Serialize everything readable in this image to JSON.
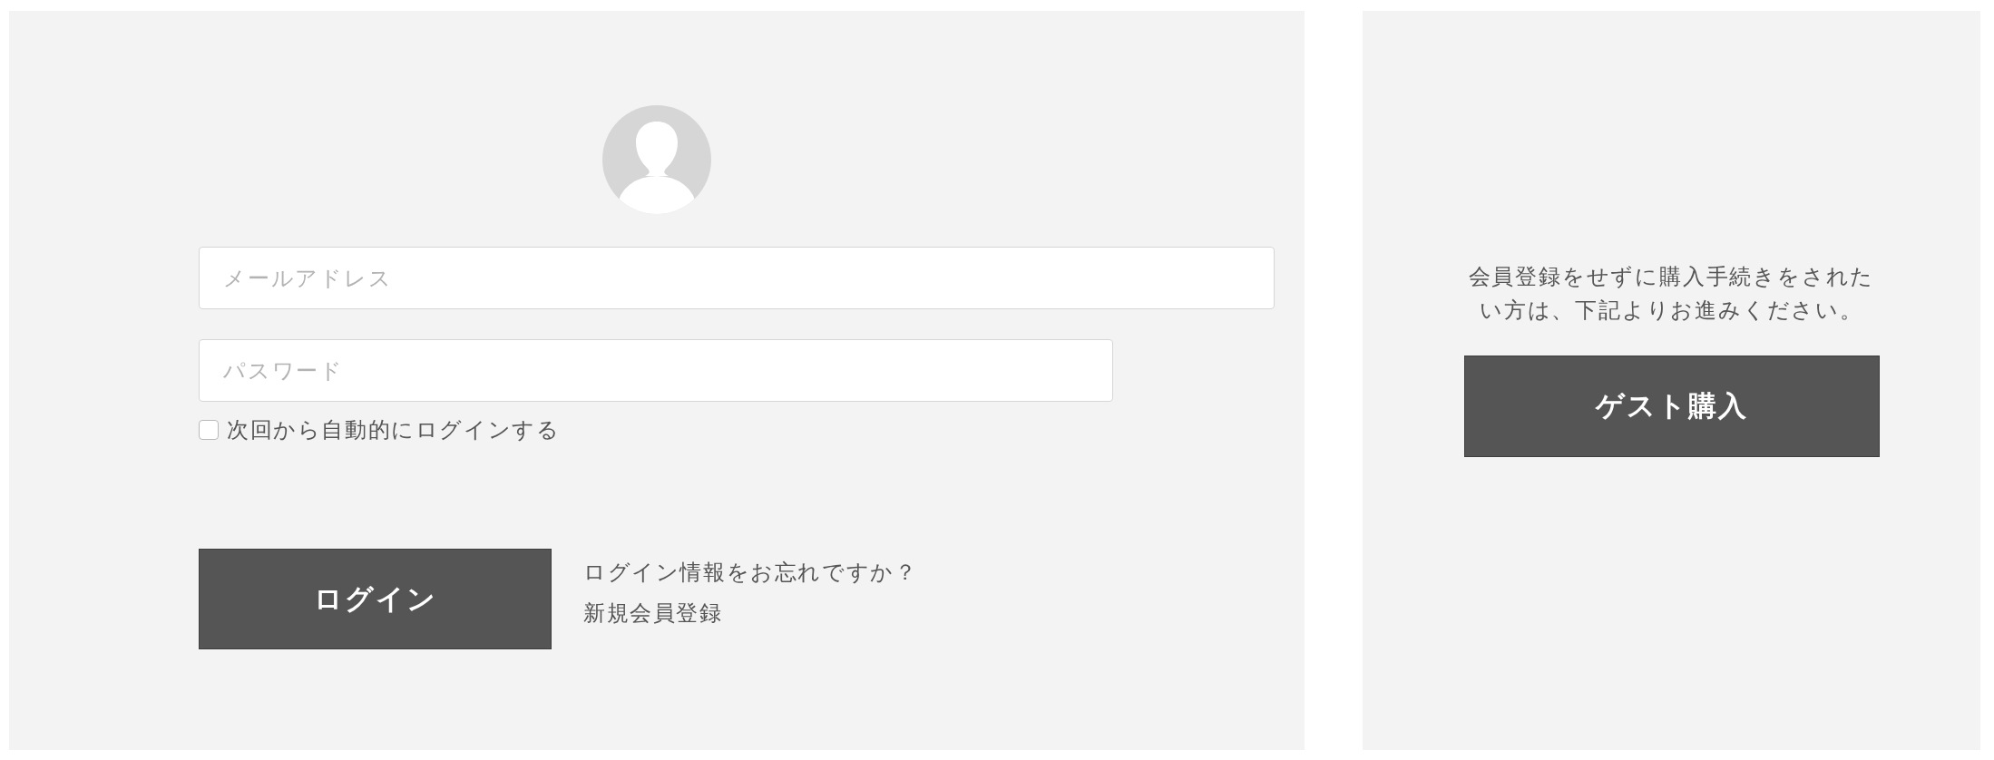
{
  "login": {
    "email_field": {
      "placeholder": "メールアドレス"
    },
    "password_field": {
      "placeholder": "パスワード"
    },
    "remember_me": {
      "label": "次回から自動的にログインする",
      "checked": false
    },
    "login_button": "ログイン",
    "forgot_link": "ログイン情報をお忘れですか？",
    "register_link": "新規会員登録"
  },
  "guest": {
    "message": "会員登録をせずに購入手続きをされたい方は、下記よりお進みください。",
    "guest_button": "ゲスト購入"
  }
}
